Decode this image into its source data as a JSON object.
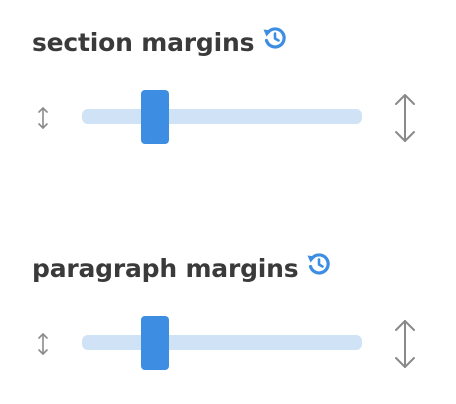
{
  "sections": [
    {
      "title": "section margins",
      "reset_icon": "history-reset-icon",
      "min_icon": "vertical-arrows-small-icon",
      "max_icon": "vertical-arrows-large-icon",
      "slider_value": 0.26
    },
    {
      "title": "paragraph margins",
      "reset_icon": "history-reset-icon",
      "min_icon": "vertical-arrows-small-icon",
      "max_icon": "vertical-arrows-large-icon",
      "slider_value": 0.26
    }
  ],
  "colors": {
    "title": "#3a3a3a",
    "accent": "#3d8ee3",
    "track": "#cfe2f6",
    "icon": "#8a8a8a"
  }
}
